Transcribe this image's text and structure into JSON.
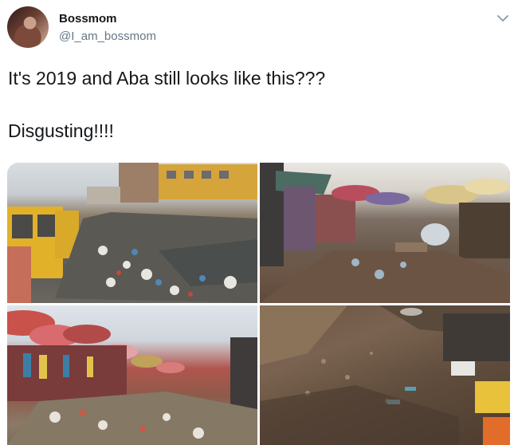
{
  "user": {
    "name": "Bossmom",
    "handle": "@I_am_bossmom"
  },
  "tweet": {
    "text": "It's 2019 and Aba still looks like this???\n\nDisgusting!!!!"
  },
  "icons": {
    "menu": "chevron-down-icon",
    "avatar": "profile-photo"
  },
  "colors": {
    "text": "#14171a",
    "secondary": "#657786"
  }
}
